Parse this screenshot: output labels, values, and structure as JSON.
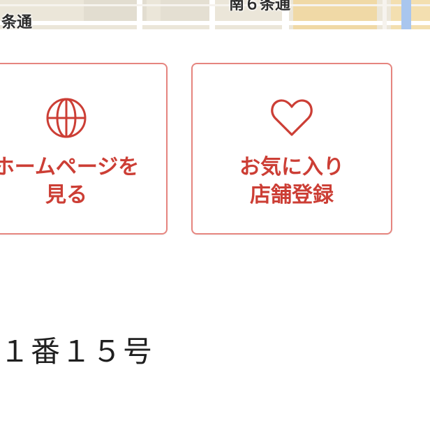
{
  "map": {
    "street_left": "条通",
    "street_right": "南６条通"
  },
  "actions": {
    "homepage": {
      "icon": "globe-icon",
      "line1": "ホームページを",
      "line2": "見る"
    },
    "favorite": {
      "icon": "heart-icon",
      "line1": "お気に入り",
      "line2": "店舗登録"
    }
  },
  "address": {
    "text": "１番１５号"
  },
  "colors": {
    "accent": "#cc3e35",
    "card_border": "#e6857f",
    "map_background": "#ebe6d9"
  }
}
